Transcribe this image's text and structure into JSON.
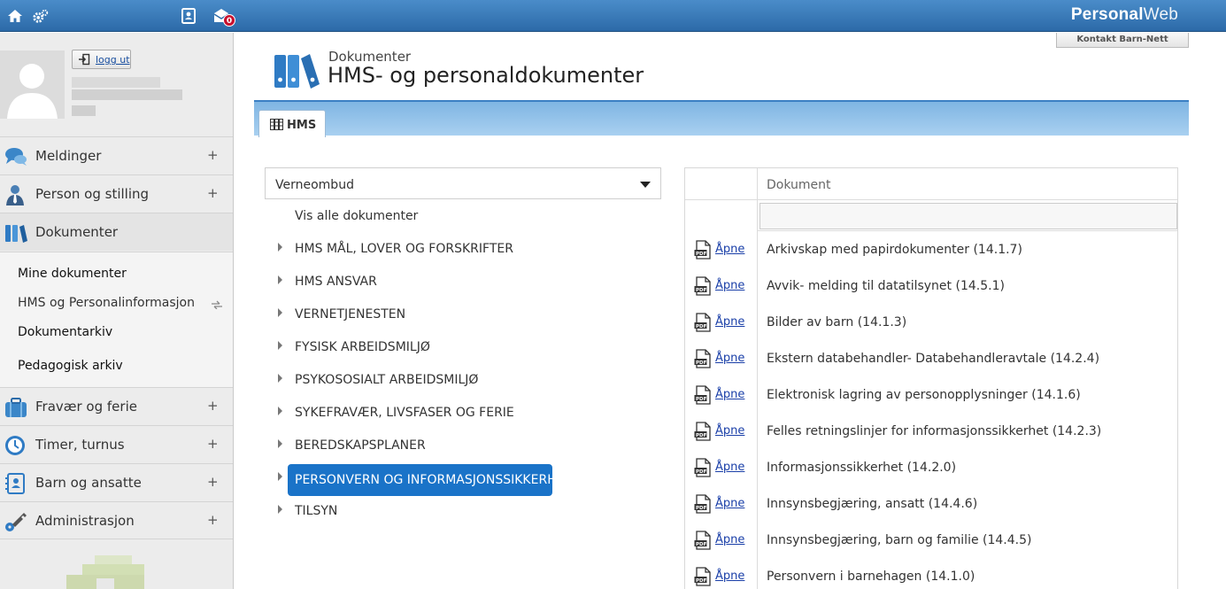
{
  "topbar": {
    "brand_strong": "Personal",
    "brand_light": "Web",
    "message_count": "0",
    "icons": [
      "home-icon",
      "settings-icon",
      "contacts-icon",
      "mail-icon"
    ]
  },
  "header": {
    "contact_label": "Kontakt Barn-Nett",
    "breadcrumb": "Dokumenter",
    "title": "HMS- og personaldokumenter"
  },
  "user": {
    "logout_label": "logg ut"
  },
  "sidebar": {
    "items": [
      {
        "label": "Meldinger",
        "expand": "+",
        "icon": "chat-icon"
      },
      {
        "label": "Person og stilling",
        "expand": "+",
        "icon": "person-icon"
      },
      {
        "label": "Dokumenter",
        "expand": "",
        "icon": "binders-icon"
      },
      {
        "label": "Fravær og ferie",
        "expand": "+",
        "icon": "suitcase-icon"
      },
      {
        "label": "Timer, turnus",
        "expand": "+",
        "icon": "clock-icon"
      },
      {
        "label": "Barn og ansatte",
        "expand": "+",
        "icon": "contact-card-icon"
      },
      {
        "label": "Administrasjon",
        "expand": "+",
        "icon": "key-icon"
      }
    ],
    "submenu": [
      {
        "label": "Mine dokumenter"
      },
      {
        "label": "HMS og Personalinformasjon"
      },
      {
        "label": "Dokumentarkiv"
      },
      {
        "label": "Pedagogisk arkiv"
      }
    ]
  },
  "tabs": [
    {
      "label": "HMS"
    }
  ],
  "filter": {
    "selected": "Verneombud",
    "show_all": "Vis alle dokumenter"
  },
  "tree": [
    "HMS MÅL, LOVER OG FORSKRIFTER",
    "HMS ANSVAR",
    "VERNETJENESTEN",
    "FYSISK ARBEIDSMILJØ",
    "PSYKOSOSIALT ARBEIDSMILJØ",
    "SYKEFRAVÆR, LIVSFASER OG FERIE",
    "BEREDSKAPSPLANER",
    "PERSONVERN OG INFORMASJONSSIKKERHET",
    "TILSYN"
  ],
  "tree_active_index": 7,
  "documents": {
    "column_header": "Dokument",
    "open_label": "Åpne",
    "rows": [
      "Arkivskap med papirdokumenter (14.1.7)",
      "Avvik- melding til datatilsynet (14.5.1)",
      "Bilder av barn (14.1.3)",
      "Ekstern databehandler- Databehandleravtale (14.2.4)",
      "Elektronisk lagring av personopplysninger (14.1.6)",
      "Felles retningslinjer for informasjonssikkerhet (14.2.3)",
      "Informasjonssikkerhet (14.2.0)",
      "Innsynsbegjæring, ansatt (14.4.6)",
      "Innsynsbegjæring, barn og familie (14.4.5)",
      "Personvern i barnehagen (14.1.0)"
    ]
  }
}
